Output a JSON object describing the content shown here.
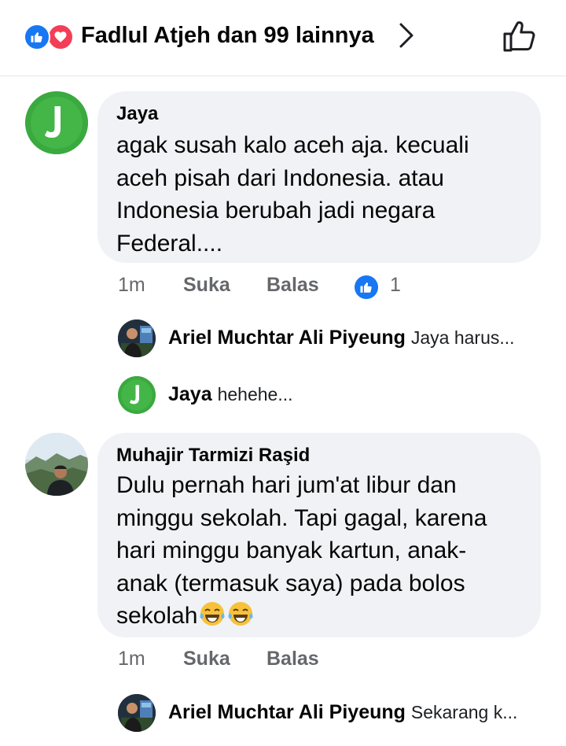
{
  "header": {
    "title": "Fadlul Atjeh dan 99 lainnya",
    "icons": [
      "like-reaction-icon",
      "love-reaction-icon",
      "chevron-right-icon",
      "thumbs-up-outline-icon"
    ],
    "colors": {
      "like": "#1877f2",
      "love": "#f33e58"
    }
  },
  "comments": [
    {
      "author": "Jaya",
      "avatar_letter": "J",
      "text": "agak susah kalo aceh aja. kecuali\naceh pisah dari Indonesia. atau\nIndonesia berubah jadi negara\nFederal....",
      "time": "1m",
      "like_label": "Suka",
      "reply_label": "Balas",
      "reaction_count": "1",
      "replies": [
        {
          "author": "Ariel Muchtar Ali Piyeung",
          "snippet": "Jaya harus..."
        },
        {
          "author": "Jaya",
          "avatar_letter": "J",
          "snippet": "hehehe..."
        }
      ]
    },
    {
      "author": "Muhajir Tarmizi Raşid",
      "text": "Dulu pernah hari jum'at libur dan\nminggu sekolah. Tapi gagal, karena\nhari minggu banyak kartun, anak-\nanak (termasuk saya) pada bolos\nsekolah",
      "emoji": "😂😂",
      "time": "1m",
      "like_label": "Suka",
      "reply_label": "Balas",
      "replies": [
        {
          "author": "Ariel Muchtar Ali Piyeung",
          "snippet": "Sekarang k..."
        }
      ]
    }
  ]
}
